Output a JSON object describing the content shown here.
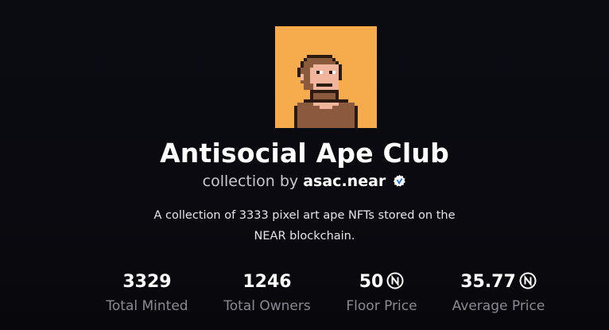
{
  "collection": {
    "title": "Antisocial Ape Club",
    "byline_prefix": "collection by",
    "creator": "asac.near",
    "description": "A collection of 3333 pixel art ape NFTs stored on the NEAR blockchain."
  },
  "stats": [
    {
      "value": "3329",
      "label": "Total Minted",
      "icon": null
    },
    {
      "value": "1246",
      "label": "Total Owners",
      "icon": null
    },
    {
      "value": "50",
      "label": "Floor Price",
      "icon": "near-icon"
    },
    {
      "value": "35.77",
      "label": "Average Price",
      "icon": "near-icon"
    }
  ],
  "colors": {
    "background": "#0a0a10",
    "avatar_background": "#f6ab4d",
    "label": "#8a8a94",
    "subtitle": "#c9c9cf"
  }
}
